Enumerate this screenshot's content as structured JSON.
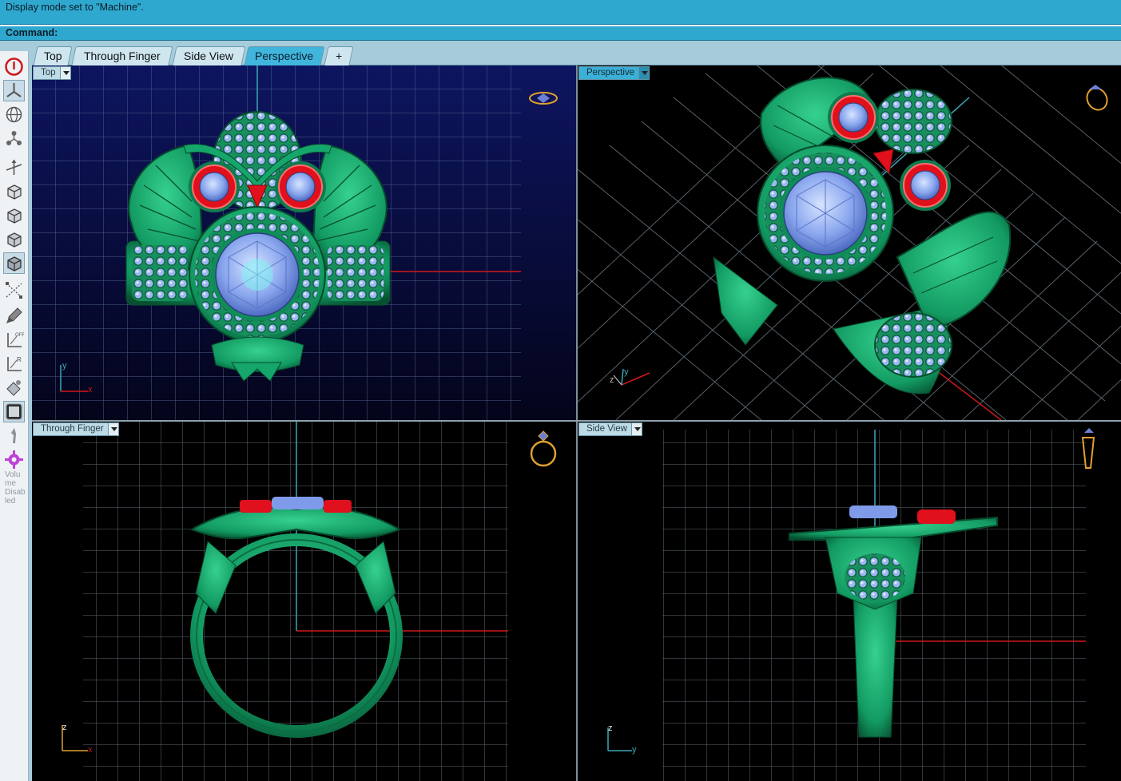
{
  "command": {
    "history": "Display mode set to \"Machine\".",
    "prompt": "Command:",
    "value": ""
  },
  "tabs": [
    {
      "label": "Top",
      "active": false
    },
    {
      "label": "Through Finger",
      "active": false
    },
    {
      "label": "Side View",
      "active": false
    },
    {
      "label": "Perspective",
      "active": true
    }
  ],
  "tab_add_label": "+",
  "toolbar": {
    "tools": [
      "stop-icon",
      "top-view-icon",
      "globe-icon",
      "nodes-icon",
      "axes-icon",
      "box-view-icon",
      "box-front-icon",
      "box-side-icon",
      "box-shaded-icon",
      "dimension-icon",
      "brush-icon",
      "ortho-off-icon",
      "ortho-r-icon",
      "render-icon",
      "panel-icon",
      "figure-icon",
      "gear-icon"
    ],
    "volume_text": "Volume Disabled"
  },
  "viewports": {
    "top": {
      "label": "Top",
      "axis_x": "x",
      "axis_y": "y"
    },
    "perspective": {
      "label": "Perspective",
      "axis_z": "z",
      "axis_y": "y"
    },
    "through": {
      "label": "Through Finger",
      "axis_z": "z",
      "axis_x": "x"
    },
    "side": {
      "label": "Side View",
      "axis_z": "z",
      "axis_y": "y"
    }
  },
  "colors": {
    "metal": "#15a66b",
    "metal_dark": "#0a5a39",
    "stone": "#7f9ae8",
    "eye": "#e0101c",
    "grid": "#5e6a73",
    "x_axis": "#d01818",
    "y_axis": "#3aa8b8",
    "widget": "#e0a030"
  }
}
